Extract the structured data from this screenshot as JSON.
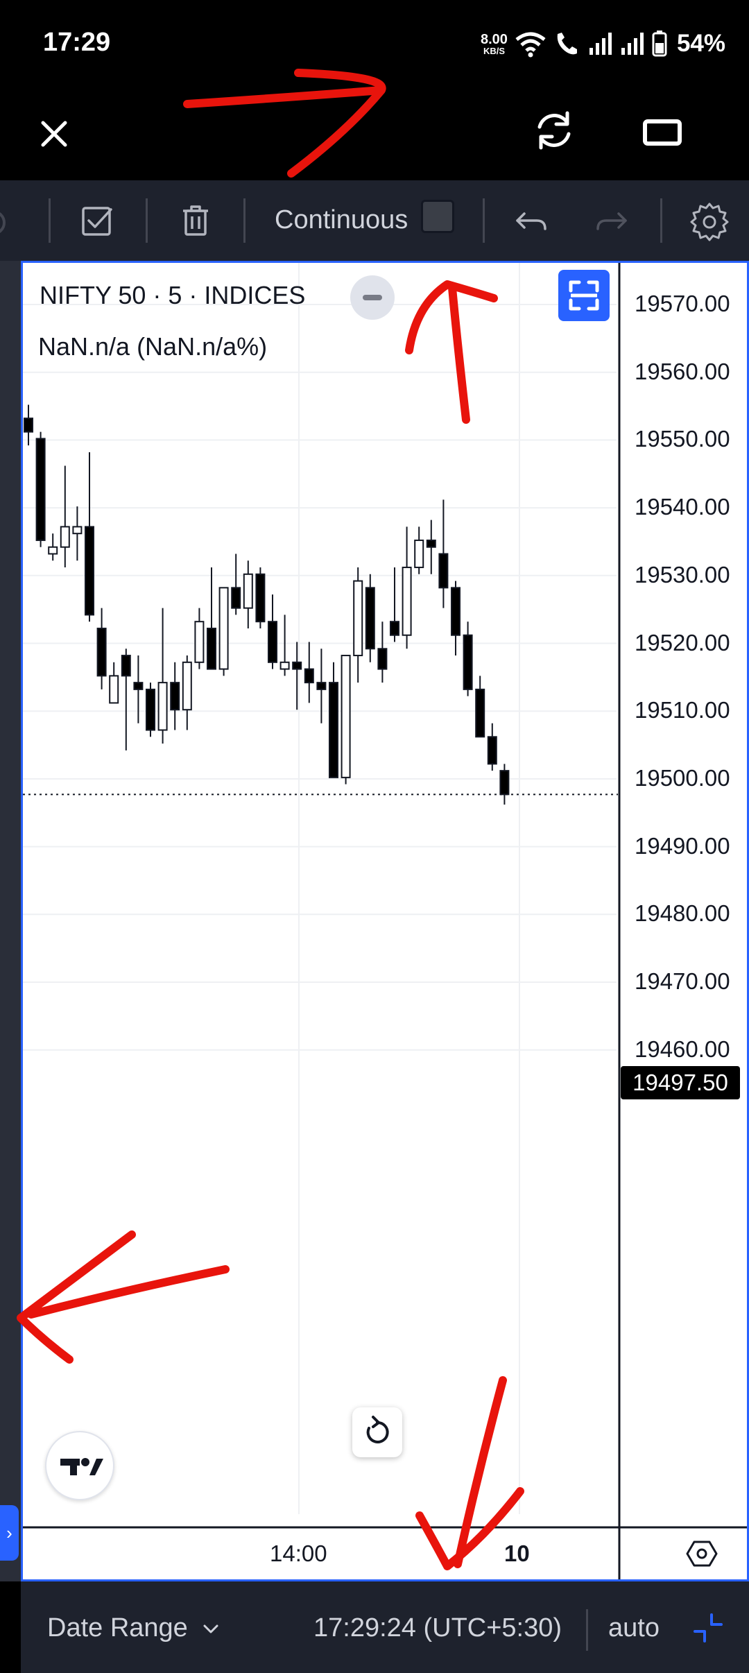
{
  "status_bar": {
    "time": "17:29",
    "net_speed": "8.00",
    "net_unit": "KB/S",
    "battery": "54%"
  },
  "toolbar": {
    "drawing_mode": "Continuous"
  },
  "chart": {
    "legend_title": "NIFTY 50 · 5 · INDICES",
    "legend_change": "NaN.n/a (NaN.n/a%)",
    "current_price": "19497.50",
    "y_ticks": [
      "19570.00",
      "19560.00",
      "19550.00",
      "19540.00",
      "19530.00",
      "19520.00",
      "19510.00",
      "19500.00",
      "19490.00",
      "19480.00",
      "19470.00",
      "19460.00"
    ],
    "x_ticks": [
      "14:00",
      "10"
    ]
  },
  "chart_data": {
    "type": "candlestick",
    "title": "NIFTY 50 · 5 · INDICES",
    "x": [
      "14:00",
      "10"
    ],
    "ylim": [
      19455,
      19577
    ],
    "last_price": 19497.5,
    "grid": true,
    "candles": [
      {
        "o": 19553,
        "h": 19555,
        "l": 19549,
        "c": 19551
      },
      {
        "o": 19550,
        "h": 19551,
        "l": 19534,
        "c": 19535
      },
      {
        "o": 19533,
        "h": 19536,
        "l": 19532,
        "c": 19534
      },
      {
        "o": 19534,
        "h": 19546,
        "l": 19531,
        "c": 19537
      },
      {
        "o": 19536,
        "h": 19540,
        "l": 19532,
        "c": 19537
      },
      {
        "o": 19537,
        "h": 19548,
        "l": 19523,
        "c": 19524
      },
      {
        "o": 19522,
        "h": 19525,
        "l": 19513,
        "c": 19515
      },
      {
        "o": 19511,
        "h": 19517,
        "l": 19512,
        "c": 19515
      },
      {
        "o": 19518,
        "h": 19519,
        "l": 19504,
        "c": 19515
      },
      {
        "o": 19514,
        "h": 19518,
        "l": 19508,
        "c": 19513
      },
      {
        "o": 19513,
        "h": 19514,
        "l": 19506,
        "c": 19507
      },
      {
        "o": 19507,
        "h": 19525,
        "l": 19505,
        "c": 19514
      },
      {
        "o": 19514,
        "h": 19517,
        "l": 19507,
        "c": 19510
      },
      {
        "o": 19510,
        "h": 19518,
        "l": 19507,
        "c": 19517
      },
      {
        "o": 19517,
        "h": 19525,
        "l": 19516,
        "c": 19523
      },
      {
        "o": 19522,
        "h": 19531,
        "l": 19518,
        "c": 19516
      },
      {
        "o": 19516,
        "h": 19528,
        "l": 19515,
        "c": 19528
      },
      {
        "o": 19528,
        "h": 19533,
        "l": 19524,
        "c": 19525
      },
      {
        "o": 19525,
        "h": 19532,
        "l": 19522,
        "c": 19530
      },
      {
        "o": 19530,
        "h": 19531,
        "l": 19522,
        "c": 19523
      },
      {
        "o": 19523,
        "h": 19527,
        "l": 19516,
        "c": 19517
      },
      {
        "o": 19516,
        "h": 19524,
        "l": 19515,
        "c": 19517
      },
      {
        "o": 19517,
        "h": 19520,
        "l": 19510,
        "c": 19516
      },
      {
        "o": 19516,
        "h": 19520,
        "l": 19511,
        "c": 19514
      },
      {
        "o": 19514,
        "h": 19519,
        "l": 19508,
        "c": 19513
      },
      {
        "o": 19514,
        "h": 19517,
        "l": 19500,
        "c": 19500
      },
      {
        "o": 19500,
        "h": 19518,
        "l": 19499,
        "c": 19518
      },
      {
        "o": 19518,
        "h": 19531,
        "l": 19514,
        "c": 19529
      },
      {
        "o": 19528,
        "h": 19530,
        "l": 19517,
        "c": 19519
      },
      {
        "o": 19519,
        "h": 19523,
        "l": 19514,
        "c": 19516
      },
      {
        "o": 19523,
        "h": 19531,
        "l": 19520,
        "c": 19521
      },
      {
        "o": 19521,
        "h": 19537,
        "l": 19519,
        "c": 19531
      },
      {
        "o": 19531,
        "h": 19537,
        "l": 19530,
        "c": 19535
      },
      {
        "o": 19535,
        "h": 19538,
        "l": 19530,
        "c": 19534
      },
      {
        "o": 19533,
        "h": 19541,
        "l": 19525,
        "c": 19528
      },
      {
        "o": 19528,
        "h": 19529,
        "l": 19518,
        "c": 19521
      },
      {
        "o": 19521,
        "h": 19523,
        "l": 19512,
        "c": 19513
      },
      {
        "o": 19513,
        "h": 19515,
        "l": 19506,
        "c": 19506
      },
      {
        "o": 19506,
        "h": 19508,
        "l": 19501,
        "c": 19502
      },
      {
        "o": 19501,
        "h": 19502,
        "l": 19496,
        "c": 19497.5
      }
    ]
  },
  "bottom_bar": {
    "date_range": "Date Range",
    "clock": "17:29:24 (UTC+5:30)",
    "auto": "auto"
  }
}
